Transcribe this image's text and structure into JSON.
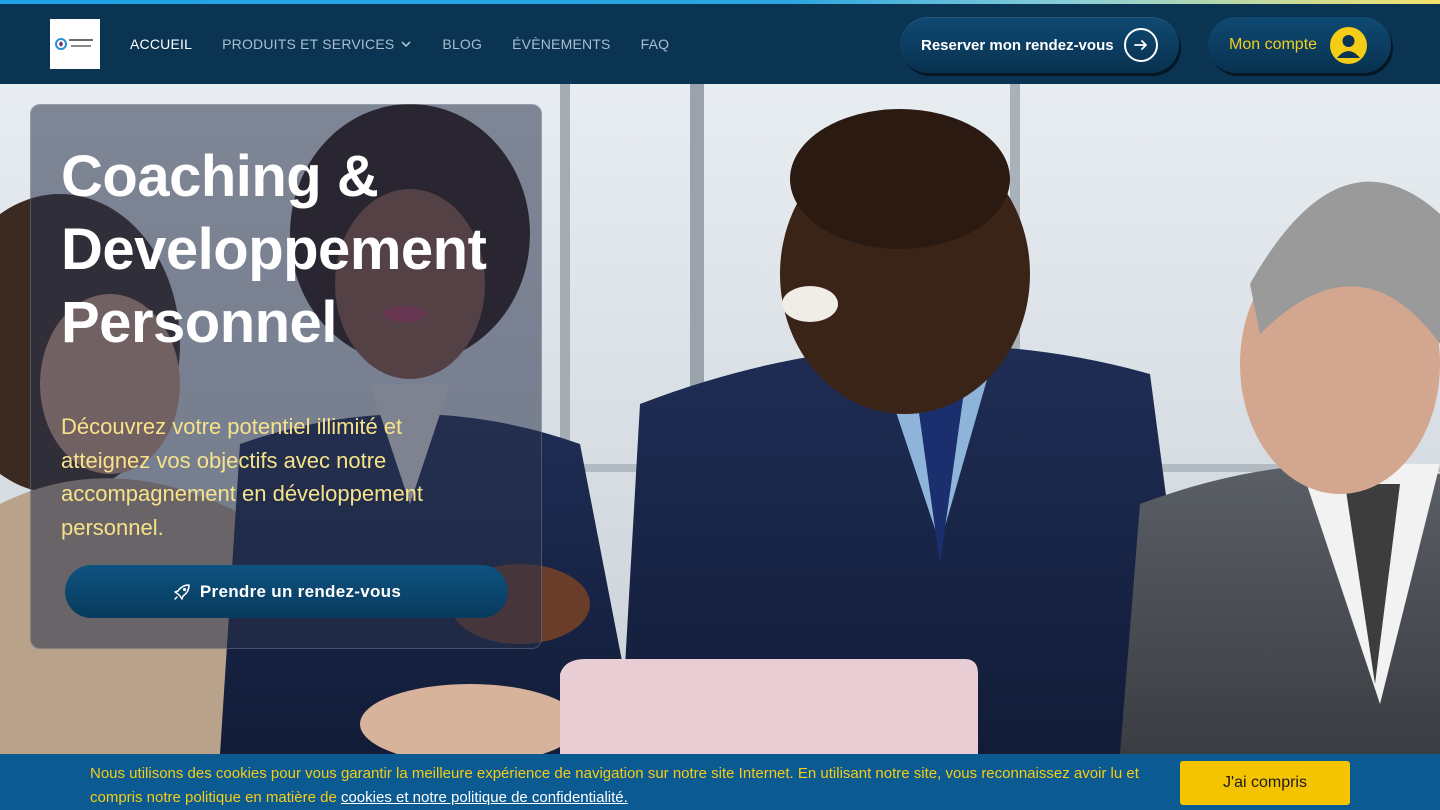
{
  "header": {
    "logo_alt": "logo",
    "nav": [
      {
        "label": "ACCUEIL",
        "active": true
      },
      {
        "label": "PRODUITS ET SERVICES",
        "has_dropdown": true
      },
      {
        "label": "BLOG"
      },
      {
        "label": "ÉVÈNEMENTS"
      },
      {
        "label": "FAQ"
      }
    ],
    "book_label": "Reserver mon rendez-vous",
    "book_icon": "arrow-right-icon",
    "account_label": "Mon compte",
    "account_icon": "user-icon"
  },
  "hero": {
    "title": "Coaching & Developpement Personnel",
    "subtitle": "Découvrez votre potentiel illimité et atteignez vos objectifs avec notre accompagnement en développement personnel.",
    "cta_label": "Prendre un rendez-vous",
    "cta_icon": "rocket-icon"
  },
  "cookie": {
    "text": "Nous utilisons des cookies pour vous garantir la meilleure expérience de navigation sur notre site Internet. En utilisant notre site, vous reconnaissez avoir lu et compris notre politique en matière de ",
    "link_text": "cookies et notre politique de confidentialité.",
    "button_label": "J'ai compris"
  },
  "colors": {
    "header_bg": "#0b3352",
    "accent_yellow": "#f5cd16",
    "cookie_bg": "#0b5a91",
    "subtitle_yellow": "#f7e28a"
  }
}
